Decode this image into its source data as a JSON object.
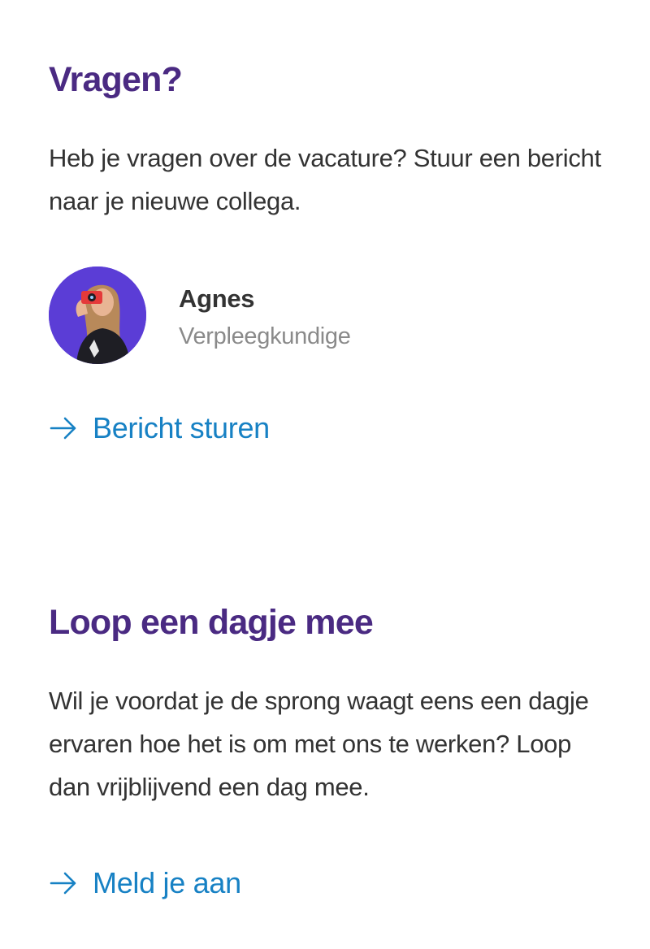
{
  "questions": {
    "title": "Vragen?",
    "description": "Heb je vragen over de vacature? Stuur een bericht naar je nieuwe collega.",
    "contact": {
      "name": "Agnes",
      "role": "Verpleegkundige"
    },
    "link_label": "Bericht sturen"
  },
  "shadow_day": {
    "title": "Loop een dagje mee",
    "description": "Wil je voordat je de sprong waagt eens een dagje ervaren hoe het is om met ons te werken? Loop dan vrijblijvend een dag mee.",
    "link_label": "Meld je aan"
  },
  "colors": {
    "heading": "#4a2a82",
    "body_text": "#333333",
    "secondary_text": "#8a8a8a",
    "link": "#1781c4",
    "avatar_background": "#5b3dd6"
  },
  "icons": {
    "link_arrow": "arrow-right-icon"
  }
}
